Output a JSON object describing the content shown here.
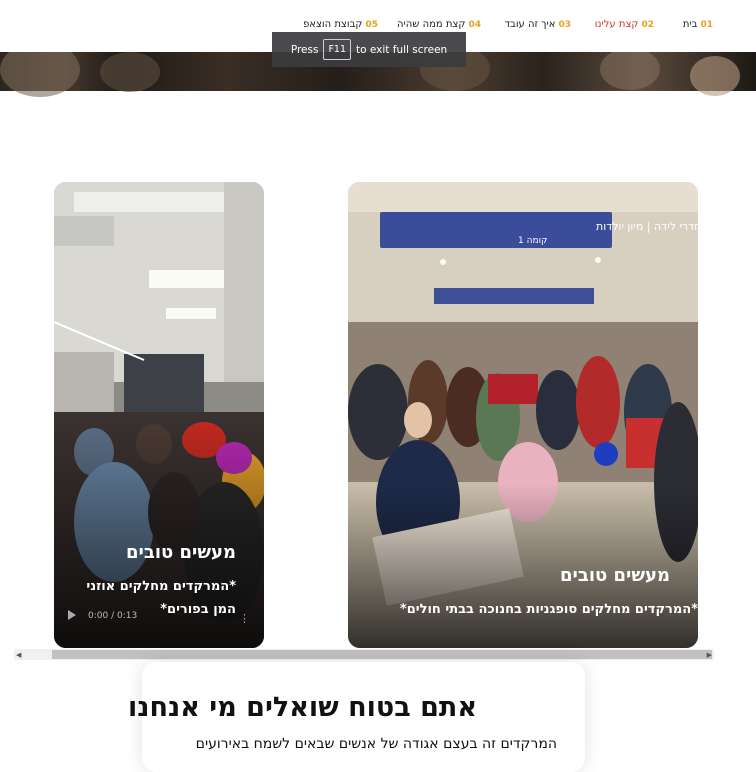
{
  "nav": {
    "items": [
      {
        "num": "01",
        "label": "בית"
      },
      {
        "num": "02",
        "label": "קצת עלינו"
      },
      {
        "num": "03",
        "label": "איך זה עובד"
      },
      {
        "num": "04",
        "label": "קצת ממה שהיה"
      },
      {
        "num": "05",
        "label": "קבוצת הוצאפ"
      }
    ],
    "active_index": 1
  },
  "fullscreen_tip": {
    "press": "Press",
    "key": "F11",
    "rest": "to exit full screen"
  },
  "cards": [
    {
      "title": "מעשים טובים",
      "desc_line1": "*המרקדים מחלקים אוזני",
      "desc_line2": "המן בפורים*",
      "video_time": "0:00 / 0:13"
    },
    {
      "title": "מעשים טובים",
      "desc_line1": "*המרקדים מחלקים סופגניות בחנוכה בבתי חולים*"
    }
  ],
  "hospital_sign": {
    "line1": "מיון נשים | חדרי לידה | מיון יולדות",
    "line2": "קומה 1"
  },
  "about": {
    "title": "אתם בטוח שואלים מי אנחנו",
    "text": "המרקדים זה בעצם אגודה של אנשים שבאים לשמח באירועים"
  },
  "colors": {
    "accent_number": "#e6a11c",
    "active_nav": "#d0342c",
    "sign_blue": "#3a4c9a"
  }
}
